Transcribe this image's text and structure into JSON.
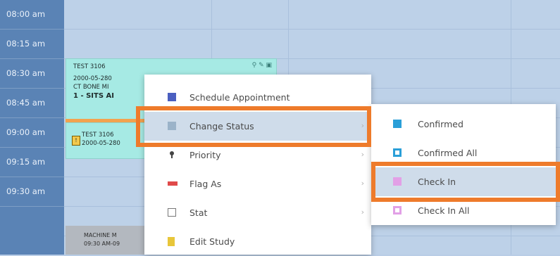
{
  "times": [
    "08:00 am",
    "08:15 am",
    "08:30 am",
    "08:45 am",
    "09:00 am",
    "09:15 am",
    "09:30 am"
  ],
  "appointment_1": {
    "lines": [
      "TEST 3106",
      "2000-05-280",
      "CT BONE MI",
      "1 - SITS AI"
    ]
  },
  "appointment_2": {
    "lines": [
      "TEST 3106",
      "2000-05-280"
    ]
  },
  "appointment_3": {
    "lines": [
      "MACHINE M",
      "09:30 AM-09"
    ]
  },
  "context_menu": [
    {
      "label": "Schedule Appointment",
      "icon": "calendar-icon",
      "icon_color": "#4b5fc0",
      "submenu": false
    },
    {
      "label": "Change Status",
      "icon": "status-icon",
      "icon_color": "#9bb3c9",
      "submenu": true
    },
    {
      "label": "Priority",
      "icon": "priority-icon",
      "icon_color": "#444444",
      "submenu": true
    },
    {
      "label": "Flag As",
      "icon": "flag-icon",
      "icon_color": "#e04a4a",
      "submenu": true
    },
    {
      "label": "Stat",
      "icon": "stat-checkbox-icon",
      "icon_color": "#777777",
      "submenu": true
    },
    {
      "label": "Edit Study",
      "icon": "edit-study-icon",
      "icon_color": "#e8c63a",
      "submenu": false
    }
  ],
  "status_submenu": [
    {
      "label": "Confirmed",
      "icon": "confirmed-icon",
      "icon_color": "#2a9fd8"
    },
    {
      "label": "Confirmed All",
      "icon": "confirmed-all-icon",
      "icon_color": "#2a9fd8"
    },
    {
      "label": "Check In",
      "icon": "check-in-icon",
      "icon_color": "#e2a0e6"
    },
    {
      "label": "Check In All",
      "icon": "check-in-all-icon",
      "icon_color": "#e2a0e6"
    }
  ],
  "colors": {
    "highlight": "#ee7b2b",
    "time_column": "#5a83b5",
    "grid": "#bdd1e8",
    "appointment": "#a6eae4"
  }
}
